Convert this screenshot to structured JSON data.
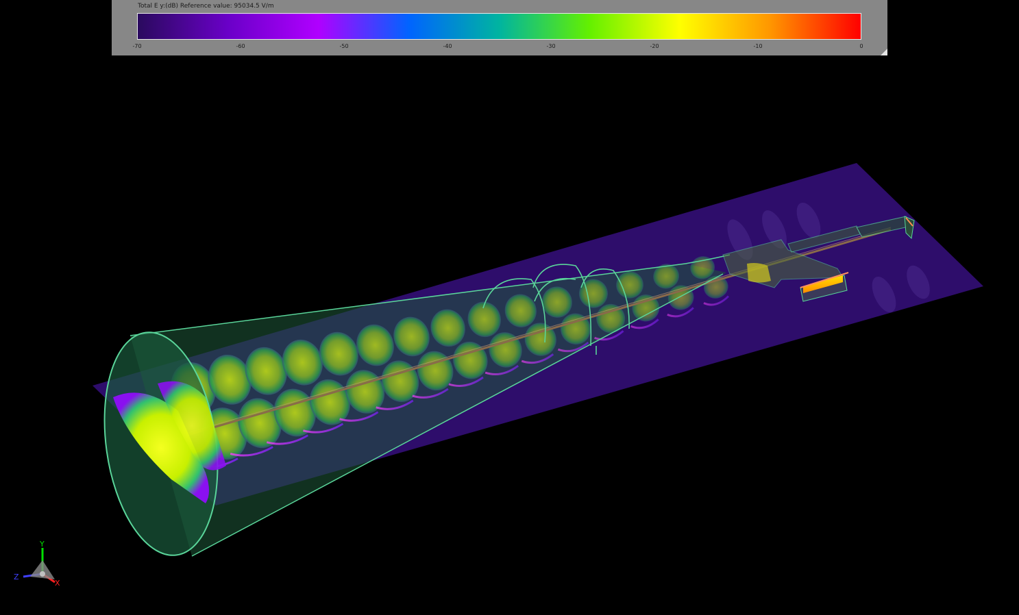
{
  "legend": {
    "title": "Total E y:(dB) Reference value: 95034.5 V/m",
    "ticks": [
      "-70",
      "-60",
      "-50",
      "-40",
      "-30",
      "-20",
      "-10",
      "0"
    ],
    "tick_values": [
      -70,
      -60,
      -50,
      -40,
      -30,
      -20,
      -10,
      0
    ],
    "range": [
      -70,
      0
    ],
    "colormap": [
      "#2a0a5e",
      "#6a00c8",
      "#b000ff",
      "#0064ff",
      "#00b4a0",
      "#64f000",
      "#ffff00",
      "#ff9600",
      "#ff0000"
    ]
  },
  "axes": {
    "y": "Y",
    "z": "Z",
    "x": "X",
    "colors": {
      "y": "#00e000",
      "z": "#4040ff",
      "x": "#ff2020"
    }
  },
  "colors": {
    "background": "#000000",
    "panel": "#878787",
    "horn_outline": "#5ad59a",
    "horn_fill": "#1f5a3a",
    "plane": "#2e0d6b",
    "field_high": "#d4f000",
    "field_mid": "#79a820"
  }
}
